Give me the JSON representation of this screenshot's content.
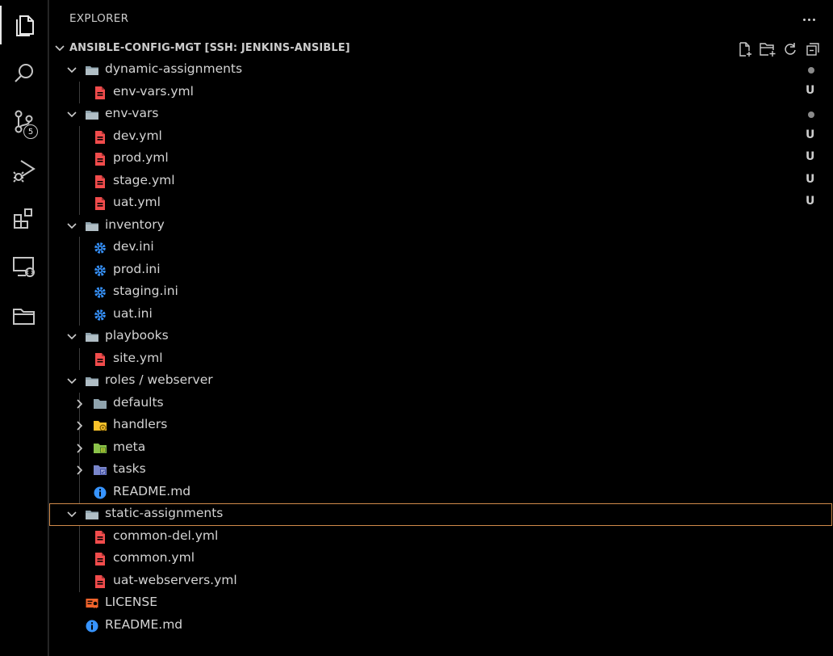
{
  "panel": {
    "title": "EXPLORER"
  },
  "section": {
    "title": "ANSIBLE-CONFIG-MGT [SSH: JENKINS-ANSIBLE]"
  },
  "activity_bar": {
    "items": [
      "explorer-icon",
      "search-icon",
      "source-control-icon",
      "run-debug-icon",
      "extensions-icon",
      "remote-explorer-icon",
      "folder-icon"
    ],
    "scm_badge": "5"
  },
  "colors": {
    "yaml_file": "#f14c4c",
    "settings_file": "#3794ff",
    "info_file": "#3794ff",
    "license_file": "#f2642c",
    "selection_border": "#d08a4a"
  },
  "tree": [
    {
      "label": "dynamic-assignments",
      "type": "folder",
      "depth": 0,
      "expanded": true,
      "status": "dot"
    },
    {
      "label": "env-vars.yml",
      "type": "yaml",
      "depth": 1,
      "status": "U"
    },
    {
      "label": "env-vars",
      "type": "folder",
      "depth": 0,
      "expanded": true,
      "status": "dot"
    },
    {
      "label": "dev.yml",
      "type": "yaml",
      "depth": 1,
      "status": "U"
    },
    {
      "label": "prod.yml",
      "type": "yaml",
      "depth": 1,
      "status": "U"
    },
    {
      "label": "stage.yml",
      "type": "yaml",
      "depth": 1,
      "status": "U"
    },
    {
      "label": "uat.yml",
      "type": "yaml",
      "depth": 1,
      "status": "U"
    },
    {
      "label": "inventory",
      "type": "folder",
      "depth": 0,
      "expanded": true,
      "status": ""
    },
    {
      "label": "dev.ini",
      "type": "ini",
      "depth": 1,
      "status": ""
    },
    {
      "label": "prod.ini",
      "type": "ini",
      "depth": 1,
      "status": ""
    },
    {
      "label": "staging.ini",
      "type": "ini",
      "depth": 1,
      "status": ""
    },
    {
      "label": "uat.ini",
      "type": "ini",
      "depth": 1,
      "status": ""
    },
    {
      "label": "playbooks",
      "type": "folder",
      "depth": 0,
      "expanded": true,
      "status": ""
    },
    {
      "label": "site.yml",
      "type": "yaml",
      "depth": 1,
      "status": ""
    },
    {
      "label": "roles / webserver",
      "type": "folder",
      "depth": 0,
      "expanded": true,
      "status": ""
    },
    {
      "label": "defaults",
      "type": "folder-grey",
      "depth": 1,
      "expanded": false,
      "status": ""
    },
    {
      "label": "handlers",
      "type": "folder-handlers",
      "depth": 1,
      "expanded": false,
      "status": ""
    },
    {
      "label": "meta",
      "type": "folder-meta",
      "depth": 1,
      "expanded": false,
      "status": ""
    },
    {
      "label": "tasks",
      "type": "folder-tasks",
      "depth": 1,
      "expanded": false,
      "status": ""
    },
    {
      "label": "README.md",
      "type": "info",
      "depth": 1,
      "status": ""
    },
    {
      "label": "static-assignments",
      "type": "folder",
      "depth": 0,
      "expanded": true,
      "status": "",
      "selected": true
    },
    {
      "label": "common-del.yml",
      "type": "yaml",
      "depth": 1,
      "status": ""
    },
    {
      "label": "common.yml",
      "type": "yaml",
      "depth": 1,
      "status": ""
    },
    {
      "label": "uat-webservers.yml",
      "type": "yaml",
      "depth": 1,
      "status": ""
    },
    {
      "label": "LICENSE",
      "type": "license",
      "depth": 0,
      "file": true,
      "status": ""
    },
    {
      "label": "README.md",
      "type": "info",
      "depth": 0,
      "file": true,
      "status": ""
    }
  ]
}
